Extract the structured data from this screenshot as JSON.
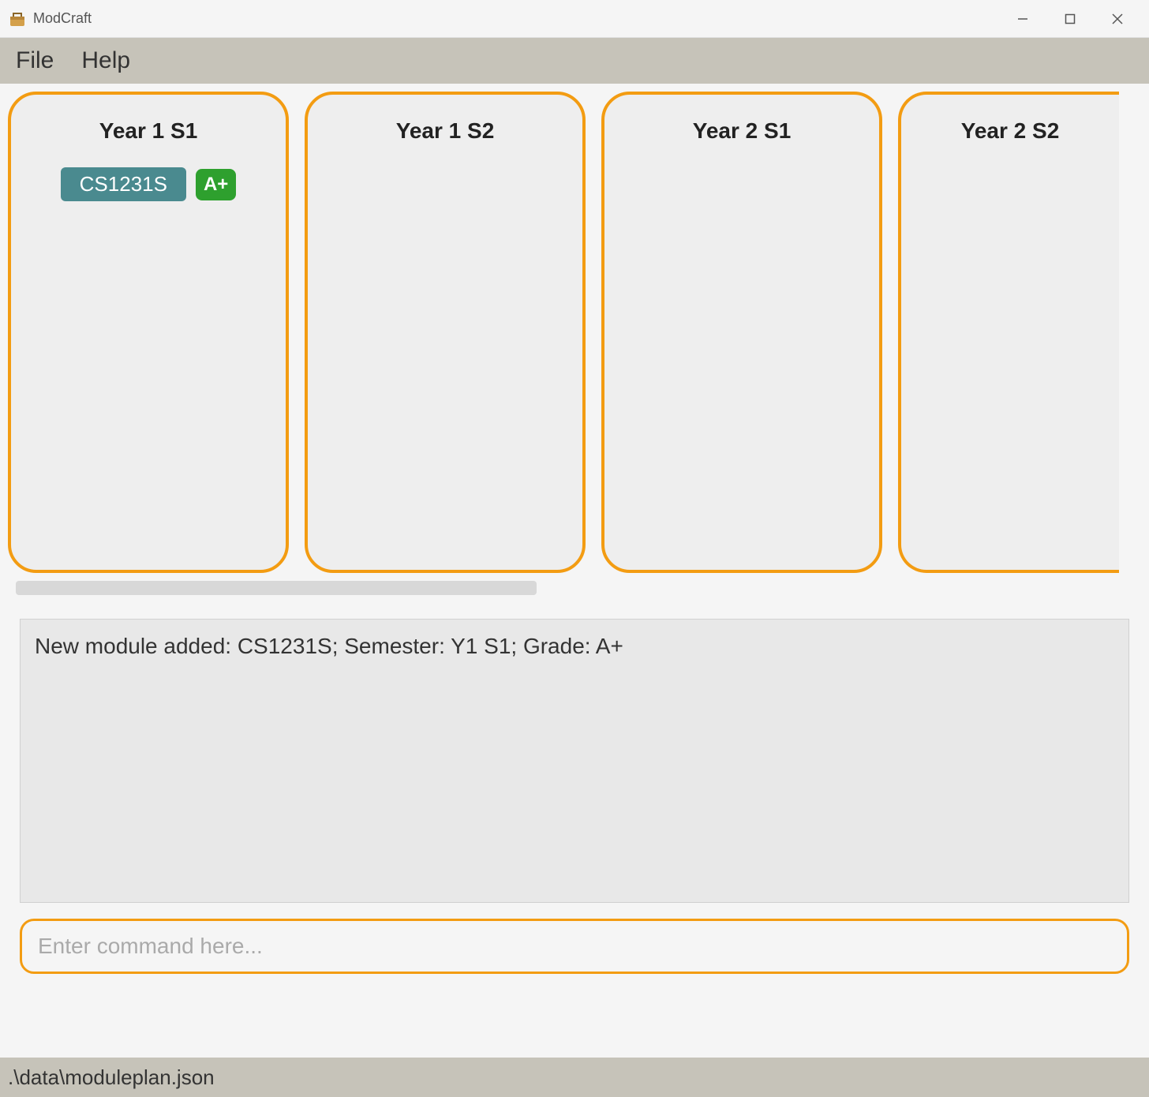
{
  "window": {
    "title": "ModCraft"
  },
  "menubar": {
    "file": "File",
    "help": "Help"
  },
  "semesters": [
    {
      "title": "Year 1 S1",
      "modules": [
        {
          "code": "CS1231S",
          "grade": "A+"
        }
      ]
    },
    {
      "title": "Year 1 S2",
      "modules": []
    },
    {
      "title": "Year 2 S1",
      "modules": []
    },
    {
      "title": "Year 2 S2",
      "modules": []
    }
  ],
  "output": {
    "message": "New module added: CS1231S; Semester: Y1 S1; Grade: A+"
  },
  "command": {
    "placeholder": "Enter command here..."
  },
  "statusbar": {
    "path": ".\\data\\moduleplan.json"
  }
}
